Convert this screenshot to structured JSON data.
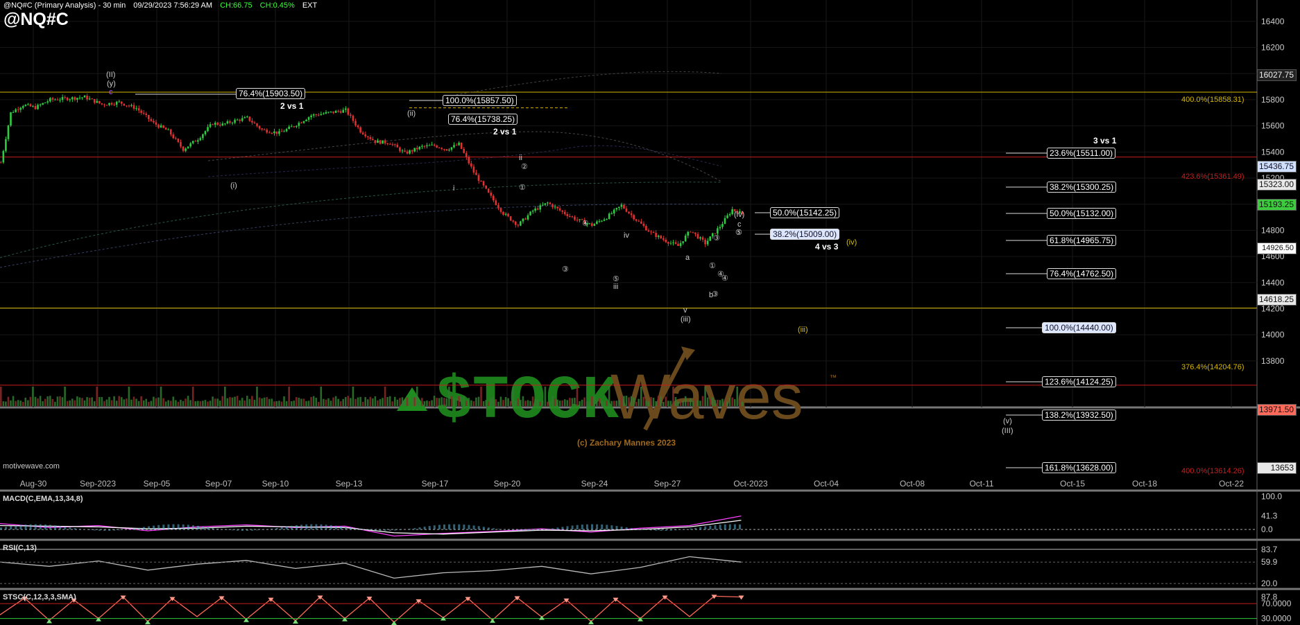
{
  "header": {
    "title": "@NQ#C (Primary Analysis) - 30 min",
    "datetime": "09/29/2023 7:56:29 AM",
    "ch": "CH:66.75",
    "ch_pct": "CH:0.45%",
    "ext": "EXT",
    "symbol": "@NQ#C"
  },
  "watermark": {
    "brand_left": "$TOCK",
    "brand_right": "Waves",
    "tm": "™",
    "copyright": "(c) Zachary Mannes 2023",
    "site": "motivewave.com"
  },
  "colors": {
    "up_candle": "#2ecc40",
    "down_candle": "#e03030",
    "yellow_level": "#d8b800",
    "red_level": "#c81e1e",
    "green_brand": "#1e8c1e",
    "brown_brand": "#6a4a1c"
  },
  "chart_data": [
    {
      "type": "line",
      "name": "price",
      "ylim": [
        13550,
        16500
      ],
      "y_ticks": [
        13800,
        14000,
        14200,
        14400,
        14600,
        14800,
        15000,
        15200,
        15400,
        15600,
        15800,
        16000,
        16200,
        16400
      ],
      "x_tick_labels": [
        "Aug-30",
        "Sep-2023",
        "Sep-05",
        "Sep-07",
        "Sep-10",
        "Sep-13",
        "Sep-17",
        "Sep-20",
        "Sep-24",
        "Sep-27",
        "Oct-2023",
        "Oct-04",
        "Oct-08",
        "Oct-11",
        "Oct-15",
        "Oct-18",
        "Oct-22"
      ],
      "series": [
        {
          "x": [
            0,
            4,
            9,
            14,
            20,
            27,
            34,
            41,
            48,
            55,
            62,
            68,
            74,
            80,
            86,
            90,
            95,
            100,
            106,
            113,
            119,
            126,
            133,
            140,
            146,
            152,
            158,
            164,
            171,
            176,
            181,
            186,
            192,
            198,
            204,
            210,
            216,
            222,
            228,
            234,
            240,
            246,
            252,
            258,
            264,
            270,
            275,
            280,
            286,
            292,
            297,
            301
          ],
          "values": [
            15320,
            15700,
            15760,
            15740,
            15800,
            15810,
            15820,
            15765,
            15780,
            15735,
            15620,
            15560,
            15420,
            15500,
            15620,
            15610,
            15640,
            15660,
            15570,
            15545,
            15600,
            15680,
            15700,
            15720,
            15560,
            15480,
            15470,
            15390,
            15440,
            15450,
            15420,
            15460,
            15245,
            15080,
            14930,
            14840,
            14950,
            15010,
            14940,
            14880,
            14840,
            14900,
            14990,
            14880,
            14780,
            14720,
            14680,
            14800,
            14700,
            14830,
            14960,
            14926
          ]
        }
      ],
      "current_price": "14926.50",
      "price_tags": [
        "16027.75",
        "15436.75",
        "15323.00",
        "15193.25",
        "14926.50",
        "14618.25",
        "13971.50",
        "13653"
      ],
      "horizontal_levels": [
        {
          "label": "400.0%(15858.31)",
          "value": 15858.31
        },
        {
          "label": "423.6%(15361.49)",
          "value": 15361.49
        },
        {
          "label": "376.4%(14204.76)",
          "value": 14204.76
        },
        {
          "label": "400.0%(13614.26)",
          "value": 13614.26
        }
      ],
      "fib_labels_mid": [
        "76.4%(15903.50)",
        "100.0%(15857.50)",
        "76.4%(15738.25)",
        "50.0%(15142.25)",
        "38.2%(15009.00)"
      ],
      "fib_labels_right": [
        "23.6%(15511.00)",
        "38.2%(15300.25)",
        "50.0%(15132.00)",
        "61.8%(14965.75)",
        "76.4%(14762.50)",
        "100.0%(14440.00)",
        "123.6%(14124.25)",
        "138.2%(13932.50)",
        "161.8%(13628.00)"
      ],
      "notes": [
        "2 vs 1",
        "2 vs 1",
        "3 vs 1",
        "4 vs 3"
      ],
      "wave_labels": [
        "(II)",
        "(y)",
        "c",
        "(i)",
        "(ii)",
        "i",
        "ii",
        "iii",
        "iv",
        "v",
        "(iii)",
        "a",
        "b",
        "c",
        "(iv)",
        "(iv)",
        "(iii)",
        "(v)",
        "(III)",
        "①",
        "②",
        "③",
        "④",
        "⑤",
        "③",
        "④",
        "⑤",
        "①",
        "③",
        "④",
        "⑤"
      ]
    },
    {
      "type": "line",
      "name": "MACD(C,EMA,13,34,8)",
      "ylim": [
        -25,
        110
      ],
      "y_ticks": [
        "100.0",
        "41.3",
        "0.0"
      ],
      "series": [
        {
          "name": "macd",
          "x": [
            0,
            20,
            40,
            60,
            80,
            100,
            120,
            140,
            160,
            180,
            200,
            220,
            240,
            260,
            280,
            301
          ],
          "values": [
            18,
            6,
            12,
            -4,
            8,
            14,
            6,
            10,
            -20,
            -12,
            -6,
            2,
            -8,
            4,
            12,
            41.3
          ]
        },
        {
          "name": "signal",
          "x": [
            0,
            20,
            40,
            60,
            80,
            100,
            120,
            140,
            160,
            180,
            200,
            220,
            240,
            260,
            280,
            301
          ],
          "values": [
            12,
            10,
            8,
            2,
            4,
            10,
            8,
            6,
            -10,
            -14,
            -8,
            -2,
            -4,
            0,
            8,
            28
          ]
        }
      ]
    },
    {
      "type": "line",
      "name": "RSI(C,13)",
      "ylim": [
        15,
        95
      ],
      "y_ticks": [
        "83.7",
        "59.9",
        "20.0"
      ],
      "series": [
        {
          "name": "rsi",
          "x": [
            0,
            20,
            40,
            60,
            80,
            100,
            120,
            140,
            160,
            180,
            200,
            220,
            240,
            260,
            280,
            301
          ],
          "values": [
            60,
            52,
            62,
            45,
            56,
            63,
            48,
            58,
            30,
            40,
            44,
            52,
            38,
            50,
            70,
            59.9
          ]
        }
      ]
    },
    {
      "type": "line",
      "name": "STSC(C,12,3,3,SMA)",
      "ylim": [
        20,
        100
      ],
      "y_ticks": [
        "87.8",
        "70.0000",
        "30.0000"
      ],
      "series": [
        {
          "name": "k",
          "x": [
            0,
            10,
            20,
            30,
            40,
            50,
            60,
            70,
            80,
            90,
            100,
            110,
            120,
            130,
            140,
            150,
            160,
            170,
            180,
            190,
            200,
            210,
            220,
            230,
            240,
            250,
            260,
            270,
            280,
            290,
            301
          ],
          "values": [
            40,
            85,
            25,
            80,
            30,
            88,
            22,
            84,
            35,
            86,
            28,
            82,
            24,
            88,
            30,
            85,
            20,
            78,
            32,
            84,
            26,
            86,
            34,
            80,
            22,
            82,
            30,
            88,
            35,
            90,
            87.8
          ]
        }
      ]
    }
  ]
}
